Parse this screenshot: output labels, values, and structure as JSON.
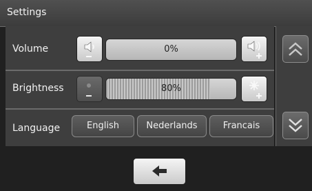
{
  "header": {
    "title": "Settings"
  },
  "rows": {
    "volume": {
      "label": "Volume",
      "value_text": "0%",
      "level": 0,
      "decrease_icon": "speaker-low-icon",
      "increase_icon": "speaker-high-icon",
      "minus": "−",
      "plus": "+"
    },
    "brightness": {
      "label": "Brightness",
      "value_text": "80%",
      "level": 0.8,
      "decrease_icon": "brightness-low-icon",
      "increase_icon": "brightness-high-icon",
      "minus": "−",
      "plus": "+"
    },
    "language": {
      "label": "Language",
      "options": [
        "English",
        "Nederlands",
        "Francais"
      ]
    }
  },
  "nav": {
    "up_icon": "double-chevron-up-icon",
    "down_icon": "double-chevron-down-icon",
    "back_icon": "arrow-left-icon"
  },
  "colors": {
    "background": "#202020",
    "panel": "#3e3e3e",
    "button_light": "#e6e6e6",
    "separator": "#6b6b6b"
  }
}
